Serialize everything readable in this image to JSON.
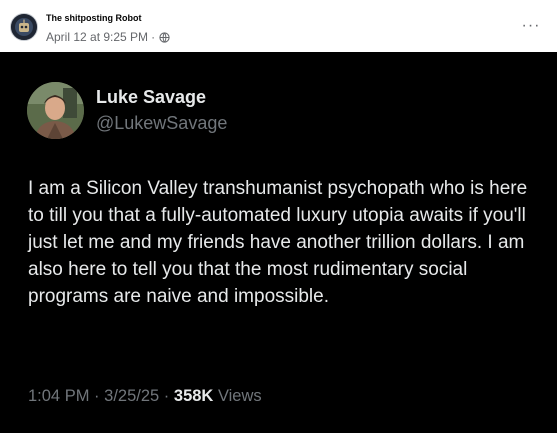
{
  "post": {
    "page_name": "The shitposting Robot",
    "timestamp": "April 12 at 9:25 PM",
    "separator": "·",
    "audience_icon": "globe-icon",
    "more_icon": "more-options-icon",
    "more_label": "···"
  },
  "tweet": {
    "author_name": "Luke Savage",
    "author_handle": "@LukewSavage",
    "text": "I am a Silicon Valley transhumanist psychopath who is here to till you that a fully-automated luxury utopia awaits if you'll just let me and my friends have another trillion dollars. I am also here to tell you that the most rudimentary social programs are naive and impossible.",
    "time": "1:04 PM",
    "date": "3/25/25",
    "separator": "·",
    "views_count": "358K",
    "views_label": "Views"
  },
  "colors": {
    "tweet_background": "#000000",
    "tweet_text": "#e7e9ea",
    "tweet_secondary": "#71767b",
    "fb_secondary": "#65676b"
  }
}
